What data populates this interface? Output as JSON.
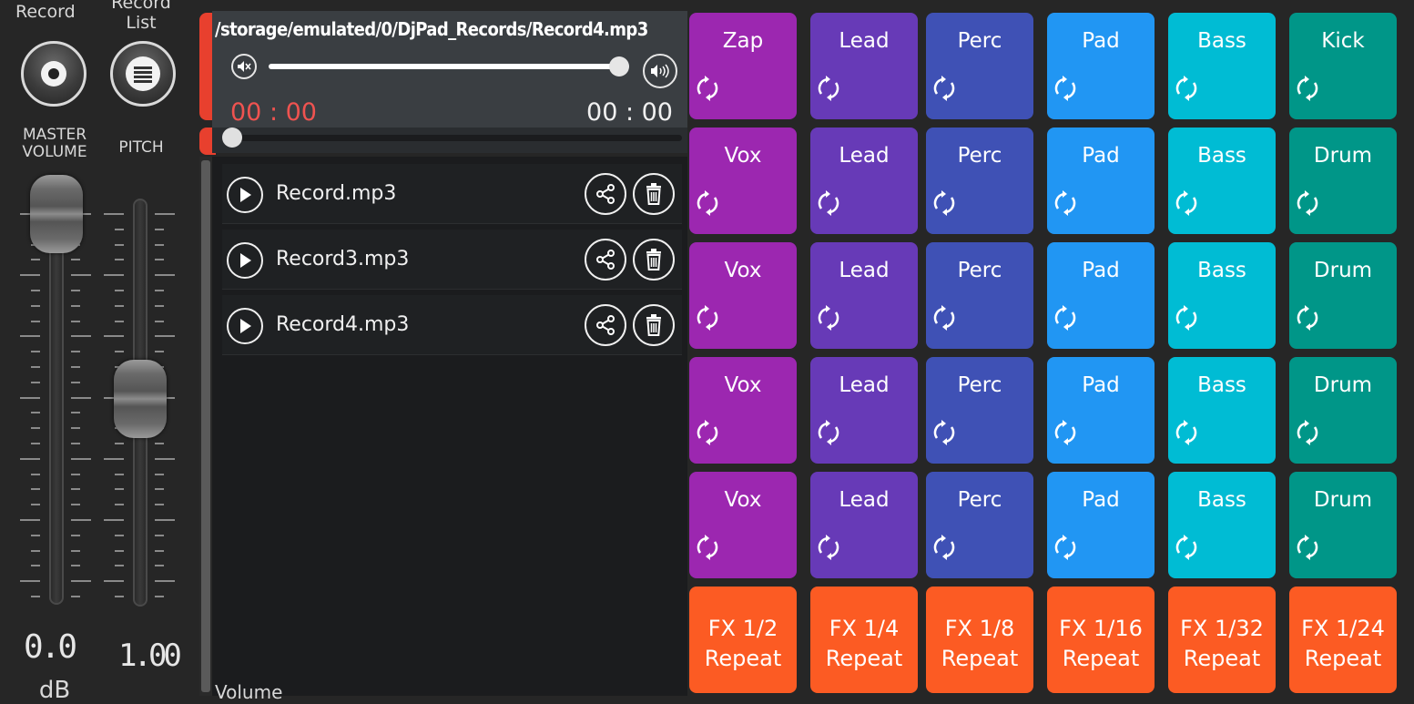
{
  "left": {
    "record_label": "Record",
    "record_list_label_line1": "Record",
    "record_list_label_line2": "List",
    "master_volume_line1": "MASTER",
    "master_volume_line2": "VOLUME",
    "pitch_label": "PITCH",
    "master_volume_value": "0.0",
    "master_volume_unit": "dB",
    "pitch_value": "1.00",
    "volume_label": "Volume"
  },
  "player": {
    "file_path": "/storage/emulated/0/DjPad_Records/Record4.mp3",
    "time_current": "00 : 00",
    "time_total": "00 : 00",
    "volume_level": 1.0,
    "seek_position": 0.0
  },
  "records": [
    {
      "name": "Record.mp3"
    },
    {
      "name": "Record3.mp3"
    },
    {
      "name": "Record4.mp3"
    }
  ],
  "pads": {
    "rows": [
      [
        "Zap",
        "Lead",
        "Perc",
        "Pad",
        "Bass",
        "Kick"
      ],
      [
        "Vox",
        "Lead",
        "Perc",
        "Pad",
        "Bass",
        "Drum"
      ],
      [
        "Vox",
        "Lead",
        "Perc",
        "Pad",
        "Bass",
        "Drum"
      ],
      [
        "Vox",
        "Lead",
        "Perc",
        "Pad",
        "Bass",
        "Drum"
      ],
      [
        "Vox",
        "Lead",
        "Perc",
        "Pad",
        "Bass",
        "Drum"
      ]
    ],
    "column_colors": [
      "#9c27b0",
      "#673ab7",
      "#3f51b5",
      "#2196f3",
      "#00bcd4",
      "#009688"
    ],
    "fx": [
      {
        "line1": "FX 1/2",
        "line2": "Repeat"
      },
      {
        "line1": "FX 1/4",
        "line2": "Repeat"
      },
      {
        "line1": "FX 1/8",
        "line2": "Repeat"
      },
      {
        "line1": "FX 1/16",
        "line2": "Repeat"
      },
      {
        "line1": "FX 1/32",
        "line2": "Repeat"
      },
      {
        "line1": "FX 1/24",
        "line2": "Repeat"
      }
    ],
    "fx_color": "#fc5b23"
  },
  "colors": {
    "accent_red": "#e8402e",
    "time_red": "#ef5350"
  }
}
